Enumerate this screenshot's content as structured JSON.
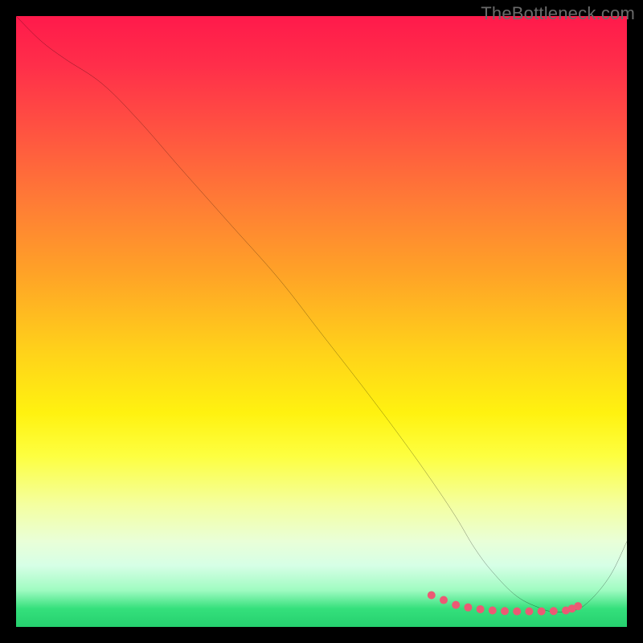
{
  "watermark": "TheBottleneck.com",
  "chart_data": {
    "type": "line",
    "title": "",
    "xlabel": "",
    "ylabel": "",
    "xlim": [
      0,
      100
    ],
    "ylim": [
      0,
      100
    ],
    "series": [
      {
        "name": "curve",
        "x": [
          0,
          4,
          8,
          14,
          20,
          27,
          35,
          43,
          50,
          57,
          63,
          68,
          72,
          75,
          78,
          82,
          86,
          88,
          90,
          93,
          97,
          100
        ],
        "values": [
          100,
          96,
          93,
          89,
          83,
          75,
          66,
          57,
          48,
          39,
          31,
          24,
          18,
          13,
          9,
          5,
          3,
          2.5,
          2.5,
          3.5,
          8,
          14
        ]
      }
    ],
    "markers": {
      "name": "highlight-dots",
      "x": [
        68,
        70,
        72,
        74,
        76,
        78,
        80,
        82,
        84,
        86,
        88,
        90,
        91,
        92
      ],
      "y": [
        5.2,
        4.4,
        3.6,
        3.2,
        2.9,
        2.7,
        2.6,
        2.55,
        2.55,
        2.55,
        2.6,
        2.7,
        3.0,
        3.4
      ],
      "color": "#eb5a74",
      "radius": 5
    },
    "gradient_stops": [
      {
        "pos": 0,
        "color": "#ff1a4b"
      },
      {
        "pos": 50,
        "color": "#ffe016"
      },
      {
        "pos": 80,
        "color": "#f2ffb0"
      },
      {
        "pos": 100,
        "color": "#25d06e"
      }
    ]
  }
}
